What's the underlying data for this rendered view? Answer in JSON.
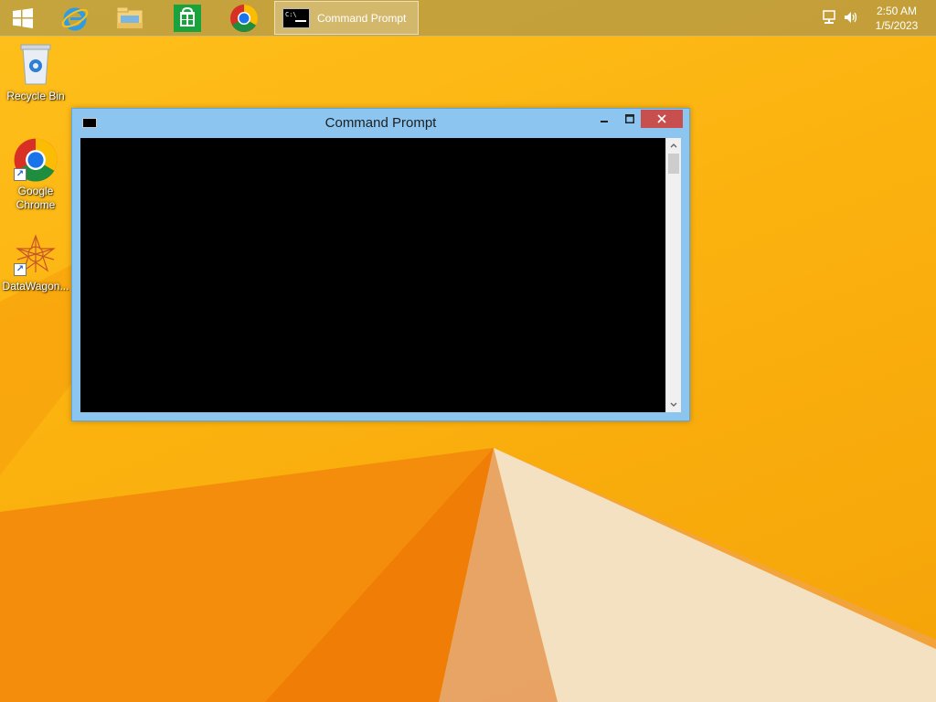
{
  "taskbar": {
    "start_icon": "windows-logo-icon",
    "pinned": [
      {
        "icon": "internet-explorer-icon"
      },
      {
        "icon": "file-explorer-icon"
      },
      {
        "icon": "windows-store-icon"
      },
      {
        "icon": "chrome-icon"
      }
    ],
    "active_task": {
      "label": "Command Prompt",
      "icon": "console-icon"
    },
    "tray": {
      "network_icon": "network-icon",
      "volume_icon": "volume-icon",
      "time": "2:50 AM",
      "date": "1/5/2023"
    }
  },
  "desktop": {
    "icons": [
      {
        "label": "Recycle Bin",
        "icon": "recycle-bin-icon"
      },
      {
        "label": "Google Chrome",
        "icon": "chrome-icon"
      },
      {
        "label": "DataWagon...",
        "icon": "datawagon-icon"
      }
    ]
  },
  "window": {
    "title": "Command Prompt",
    "console_text": "",
    "controls": {
      "minimize": "minimize-icon",
      "maximize": "maximize-icon",
      "close": "close-icon"
    }
  },
  "colors": {
    "wallpaper": "#fbb20f",
    "window_frame": "#8cc6f0",
    "close_button": "#c7504f",
    "console_background": "#000000"
  }
}
